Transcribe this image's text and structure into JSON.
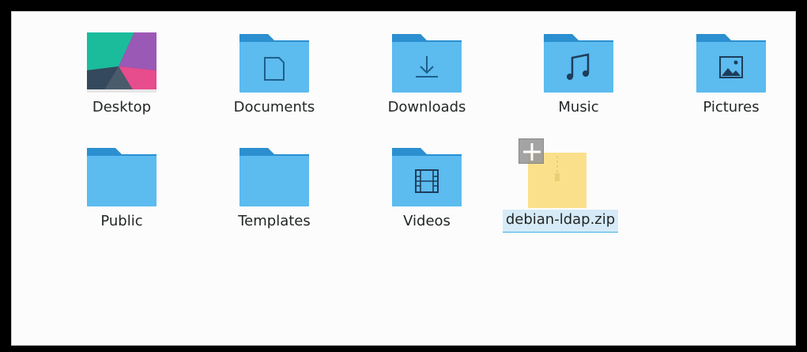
{
  "files": [
    {
      "name": "Desktop",
      "icon": "desktop-wallpaper-icon"
    },
    {
      "name": "Documents",
      "icon": "documents-folder-icon"
    },
    {
      "name": "Downloads",
      "icon": "downloads-folder-icon"
    },
    {
      "name": "Music",
      "icon": "music-folder-icon"
    },
    {
      "name": "Pictures",
      "icon": "pictures-folder-icon"
    },
    {
      "name": "Public",
      "icon": "folder-icon"
    },
    {
      "name": "Templates",
      "icon": "folder-icon"
    },
    {
      "name": "Videos",
      "icon": "videos-folder-icon"
    },
    {
      "name": "debian-ldap.zip",
      "icon": "zip-archive-icon",
      "selected": true
    }
  ],
  "colors": {
    "folder_body": "#5cbbef",
    "folder_tab": "#2b8fd0",
    "selection_bg": "#d6ebf7",
    "selection_border": "#3daee9",
    "zip_body": "#fbe08c"
  }
}
